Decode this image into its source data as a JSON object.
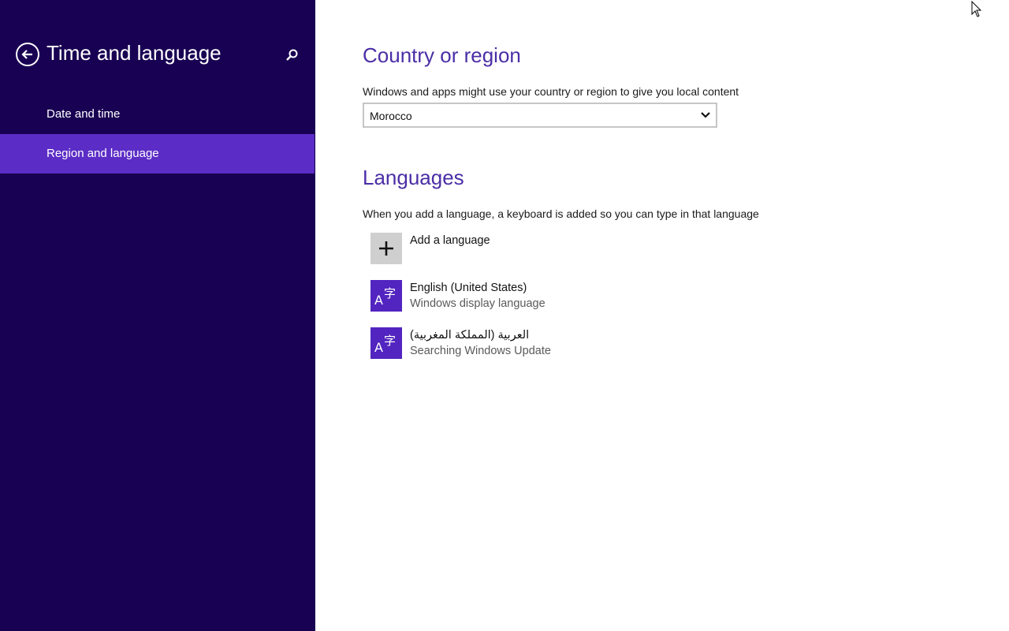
{
  "sidebar": {
    "title": "Time and language",
    "back_icon": "back-arrow-icon",
    "search_icon": "search-icon",
    "items": [
      {
        "label": "Date and time",
        "selected": false
      },
      {
        "label": "Region and language",
        "selected": true
      }
    ],
    "colors": {
      "background": "#180052",
      "selected": "#5c2dc6"
    }
  },
  "main": {
    "country": {
      "title": "Country or region",
      "description": "Windows and apps might use your country or region to give you local content",
      "selected_value": "Morocco"
    },
    "languages": {
      "title": "Languages",
      "description": "When you add a language, a keyboard is added so you can type in that language",
      "add_label": "Add a language",
      "items": [
        {
          "name": "English (United States)",
          "status": "Windows display language"
        },
        {
          "name": "العربية (المملكة المغربية)",
          "status": "Searching Windows Update"
        }
      ]
    },
    "colors": {
      "accent_title": "#4b2ea6",
      "language_tile": "#5224c0"
    }
  }
}
